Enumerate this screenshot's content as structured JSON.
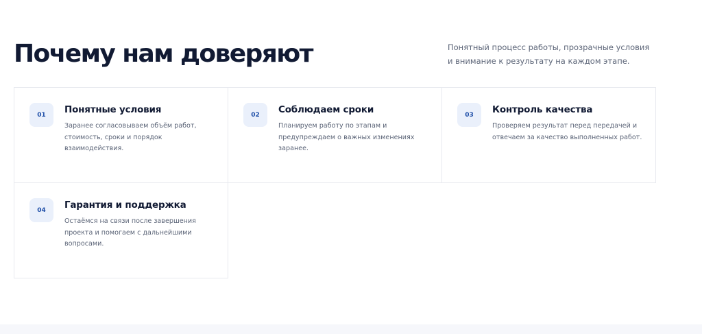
{
  "section": {
    "title": "Почему нам доверяют",
    "subtitle": "Понятный процесс работы, прозрачные условия и внимание к результату на каждом этапе."
  },
  "cards": [
    {
      "number": "01",
      "title": "Понятные условия",
      "text": "Заранее согласовываем объём работ, стоимость, сроки и порядок взаимодействия."
    },
    {
      "number": "02",
      "title": "Соблюдаем сроки",
      "text": "Планируем работу по этапам и предупреждаем о важных изменениях заранее."
    },
    {
      "number": "03",
      "title": "Контроль качества",
      "text": "Проверяем результат перед передачей и отвечаем за качество выполненных работ."
    },
    {
      "number": "04",
      "title": "Гарантия и поддержка",
      "text": "Остаёмся на связи после завершения проекта и помогаем с дальнейшими вопросами."
    }
  ],
  "colors": {
    "title": "#111a33",
    "text": "#5b6477",
    "badge_bg": "#eaf0fb",
    "badge_text": "#1f4fa8",
    "border": "#e7e9ef"
  }
}
